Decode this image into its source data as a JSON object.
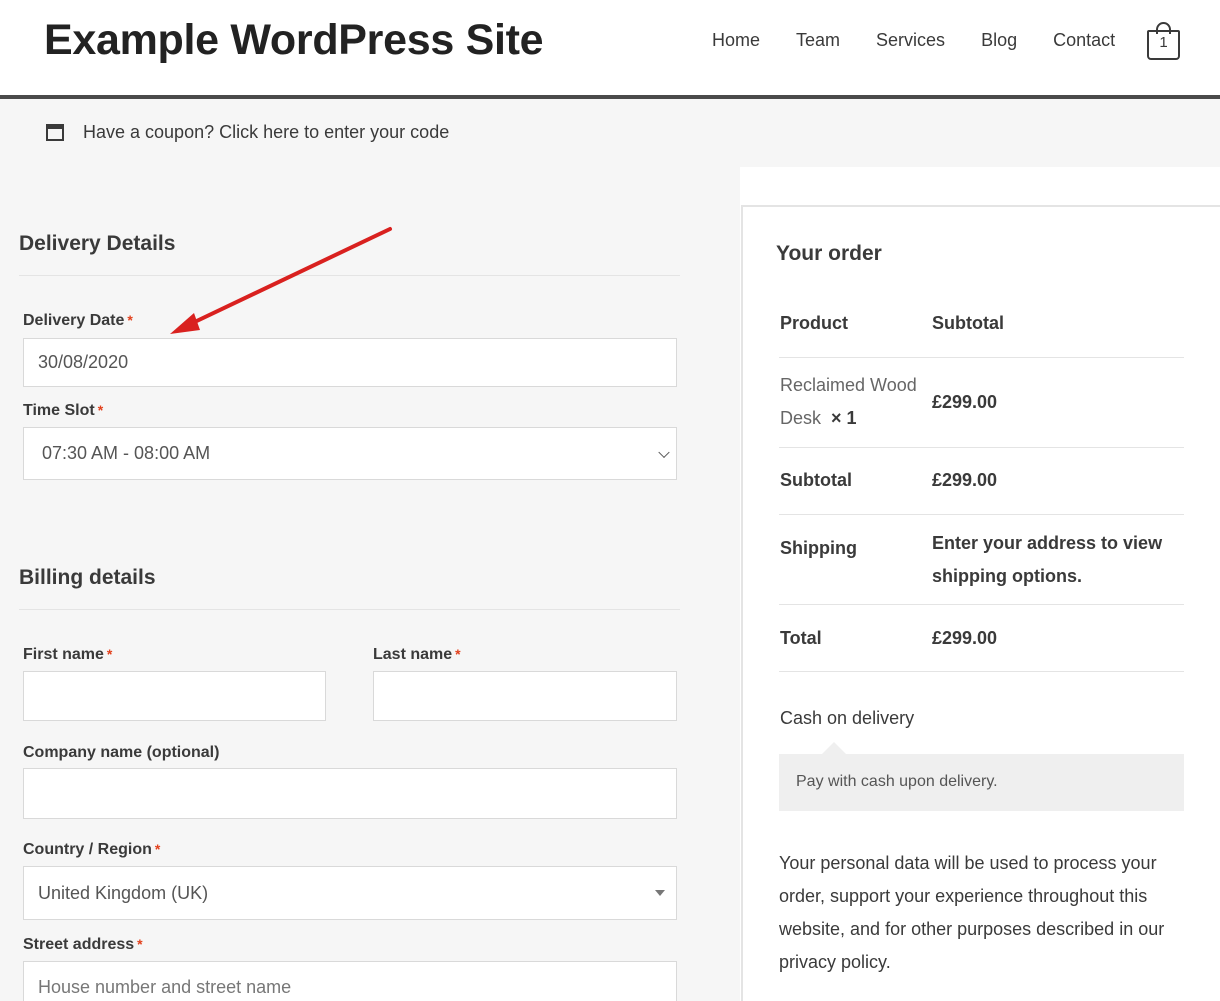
{
  "site": {
    "title": "Example WordPress Site"
  },
  "nav": {
    "items": [
      "Home",
      "Team",
      "Services",
      "Blog",
      "Contact"
    ]
  },
  "cart": {
    "count": "1",
    "icon": "shopping-bag-icon"
  },
  "coupon": {
    "icon": "coupon-window-icon",
    "text": "Have a coupon? Click here to enter your code"
  },
  "delivery": {
    "title": "Delivery Details",
    "date_label": "Delivery Date",
    "date_value": "30/08/2020",
    "slot_label": "Time Slot",
    "slot_value": "07:30 AM - 08:00 AM",
    "required_mark": "*"
  },
  "billing": {
    "title": "Billing details",
    "first_name_label": "First name",
    "last_name_label": "Last name",
    "company_label": "Company name (optional)",
    "country_label": "Country / Region",
    "country_value": "United Kingdom (UK)",
    "street_label": "Street address",
    "street_placeholder": "House number and street name"
  },
  "order": {
    "title": "Your order",
    "col_product": "Product",
    "col_subtotal": "Subtotal",
    "item_name_line1": "Reclaimed Wood",
    "item_name_line2": "Desk",
    "item_qty": "× 1",
    "item_price": "£299.00",
    "subtotal_label": "Subtotal",
    "subtotal_value": "£299.00",
    "shipping_label": "Shipping",
    "shipping_value_line1": "Enter your address to view",
    "shipping_value_line2": "shipping options.",
    "total_label": "Total",
    "total_value": "£299.00",
    "payment_method": "Cash on delivery",
    "payment_description": "Pay with cash upon delivery.",
    "privacy_text": "Your personal data will be used to process your order, support your experience throughout this website, and for other purposes described in our privacy policy."
  },
  "colors": {
    "accent_arrow": "#d9211f",
    "required": "#e2401c"
  }
}
